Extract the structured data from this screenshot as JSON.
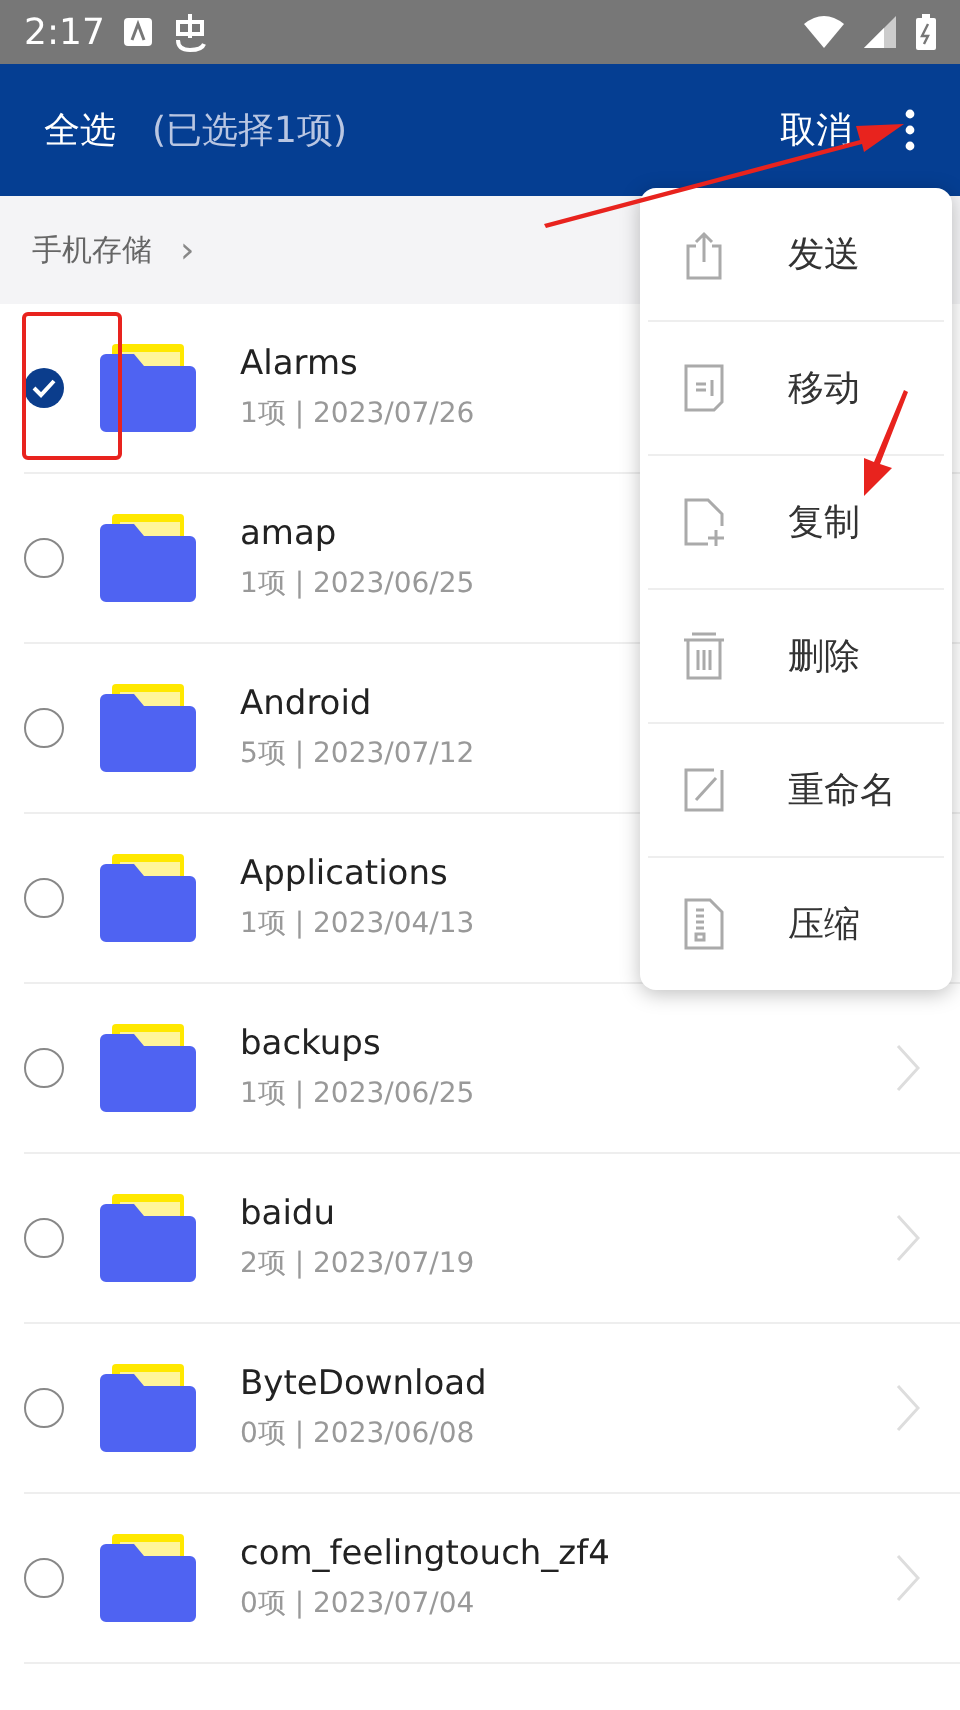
{
  "status_bar": {
    "time": "2:17"
  },
  "header": {
    "select_all": "全选",
    "selection_count": "(已选择1项)",
    "cancel": "取消"
  },
  "breadcrumb": {
    "label": "手机存储",
    "chevron": "›"
  },
  "files": [
    {
      "name": "Alarms",
      "meta": "1项 | 2023/07/26",
      "selected": true
    },
    {
      "name": "amap",
      "meta": "1项 | 2023/06/25",
      "selected": false
    },
    {
      "name": "Android",
      "meta": "5项 | 2023/07/12",
      "selected": false
    },
    {
      "name": "Applications",
      "meta": "1项 | 2023/04/13",
      "selected": false
    },
    {
      "name": "backups",
      "meta": "1项 | 2023/06/25",
      "selected": false
    },
    {
      "name": "baidu",
      "meta": "2项 | 2023/07/19",
      "selected": false
    },
    {
      "name": "ByteDownload",
      "meta": "0项 | 2023/06/08",
      "selected": false
    },
    {
      "name": "com_feelingtouch_zf4",
      "meta": "0项 | 2023/07/04",
      "selected": false
    }
  ],
  "menu": [
    {
      "kind": "send",
      "label": "发送"
    },
    {
      "kind": "move",
      "label": "移动"
    },
    {
      "kind": "copy",
      "label": "复制"
    },
    {
      "kind": "delete",
      "label": "删除"
    },
    {
      "kind": "rename",
      "label": "重命名"
    },
    {
      "kind": "compress",
      "label": "压缩"
    }
  ]
}
